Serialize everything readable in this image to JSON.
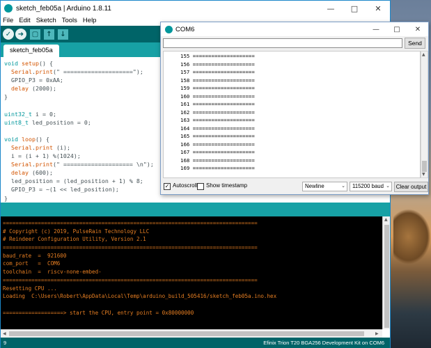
{
  "ide": {
    "title": "sketch_feb05a | Arduino 1.8.11",
    "menu": [
      "File",
      "Edit",
      "Sketch",
      "Tools",
      "Help"
    ],
    "tab": "sketch_feb05a",
    "code": [
      [
        {
          "t": "void",
          "c": "kw-type"
        },
        {
          "t": " "
        },
        {
          "t": "setup",
          "c": "kw-fn"
        },
        {
          "t": "() {"
        }
      ],
      [
        {
          "t": "  "
        },
        {
          "t": "Serial",
          "c": "kw-serial"
        },
        {
          "t": "."
        },
        {
          "t": "print",
          "c": "kw-serial"
        },
        {
          "t": "(\" ====================\");"
        }
      ],
      [
        {
          "t": "  GPIO_P3 = 0xAA;"
        }
      ],
      [
        {
          "t": "  "
        },
        {
          "t": "delay",
          "c": "kw-serial"
        },
        {
          "t": " (2000);"
        }
      ],
      [
        {
          "t": "}"
        }
      ],
      [
        {
          "t": ""
        }
      ],
      [
        {
          "t": "uint32_t",
          "c": "kw-type"
        },
        {
          "t": " i = 0;"
        }
      ],
      [
        {
          "t": "uint8_t",
          "c": "kw-type"
        },
        {
          "t": " led_position = 0;"
        }
      ],
      [
        {
          "t": ""
        }
      ],
      [
        {
          "t": "void",
          "c": "kw-type"
        },
        {
          "t": " "
        },
        {
          "t": "loop",
          "c": "kw-fn"
        },
        {
          "t": "() {"
        }
      ],
      [
        {
          "t": "  "
        },
        {
          "t": "Serial",
          "c": "kw-serial"
        },
        {
          "t": "."
        },
        {
          "t": "print",
          "c": "kw-serial"
        },
        {
          "t": " (i);"
        }
      ],
      [
        {
          "t": "  i = (i + 1) %(1024);"
        }
      ],
      [
        {
          "t": "  "
        },
        {
          "t": "Serial",
          "c": "kw-serial"
        },
        {
          "t": "."
        },
        {
          "t": "print",
          "c": "kw-serial"
        },
        {
          "t": "(\" ==================== \\n\");"
        }
      ],
      [
        {
          "t": "  "
        },
        {
          "t": "delay",
          "c": "kw-serial"
        },
        {
          "t": " (600);"
        }
      ],
      [
        {
          "t": "  led_position = (led_position + 1) % 8;"
        }
      ],
      [
        {
          "t": "  GPIO_P3 = ~(1 << led_position);"
        }
      ],
      [
        {
          "t": "}"
        }
      ]
    ],
    "console_lines": [
      "================================================================================",
      "# Copyright (c) 2019, PulseRain Technology LLC",
      "# Reindeer Configuration Utility, Version 2.1",
      "================================================================================",
      "baud_rate  =  921600",
      "com_port   =  COM6",
      "toolchain  =  riscv-none-embed-",
      "================================================================================",
      "Resetting CPU ...",
      "Loading  C:\\Users\\Robert\\AppData\\Local\\Temp\\arduino_build_505416/sketch_feb05a.ino.hex",
      "",
      "===================> start the CPU, entry point = 0x80000000"
    ],
    "status_line": "9",
    "status_board": "Efinix Trion T20 BGA256 Development Kit on COM6"
  },
  "serial": {
    "title": "COM6",
    "send_label": "Send",
    "input_value": "",
    "lines": [
      "155 ====================",
      "156 ====================",
      "157 ====================",
      "158 ====================",
      "159 ====================",
      "160 ====================",
      "161 ====================",
      "162 ====================",
      "163 ====================",
      "164 ====================",
      "165 ====================",
      "166 ====================",
      "167 ====================",
      "168 ====================",
      "169 ===================="
    ],
    "autoscroll_label": "Autoscroll",
    "autoscroll_checked": true,
    "timestamp_label": "Show timestamp",
    "timestamp_checked": false,
    "line_ending": "Newline",
    "baud": "115200 baud",
    "clear_label": "Clear output"
  }
}
